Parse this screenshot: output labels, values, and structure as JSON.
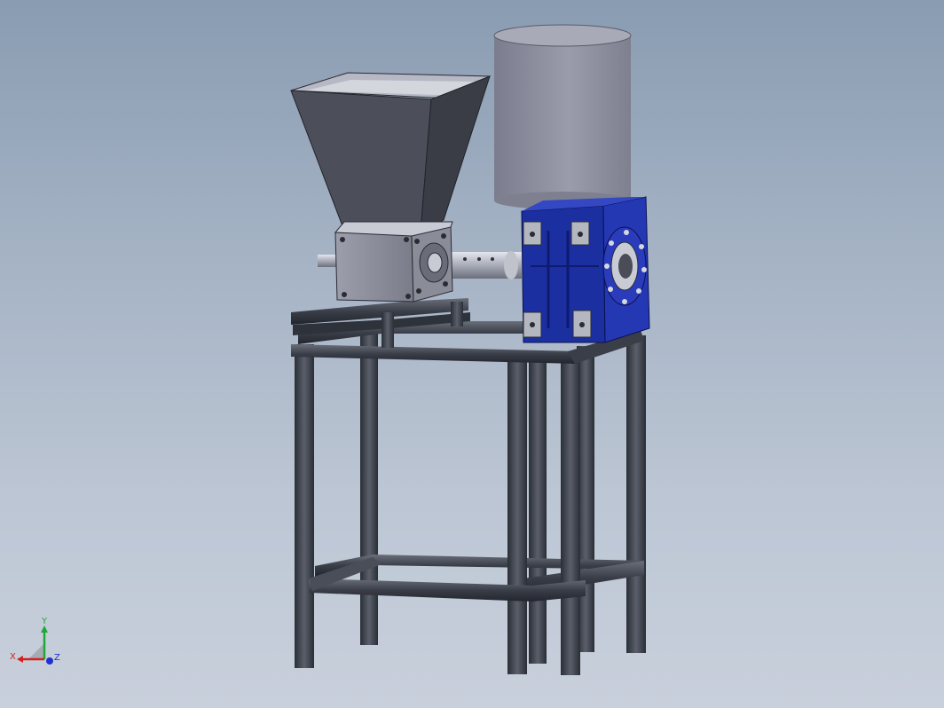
{
  "triad": {
    "x_label": "X",
    "y_label": "Y",
    "z_label": "Z",
    "x_color": "#d42020",
    "y_color": "#1fa83a",
    "z_color": "#2030d0"
  },
  "colors": {
    "background_top": "#8a9cb2",
    "background_bottom": "#c9d0dc",
    "gearbox_blue": "#1c2fa0",
    "motor_grey": "#8a8c9c",
    "hopper_grey": "#5a5c68",
    "frame_dark": "#30343c"
  }
}
